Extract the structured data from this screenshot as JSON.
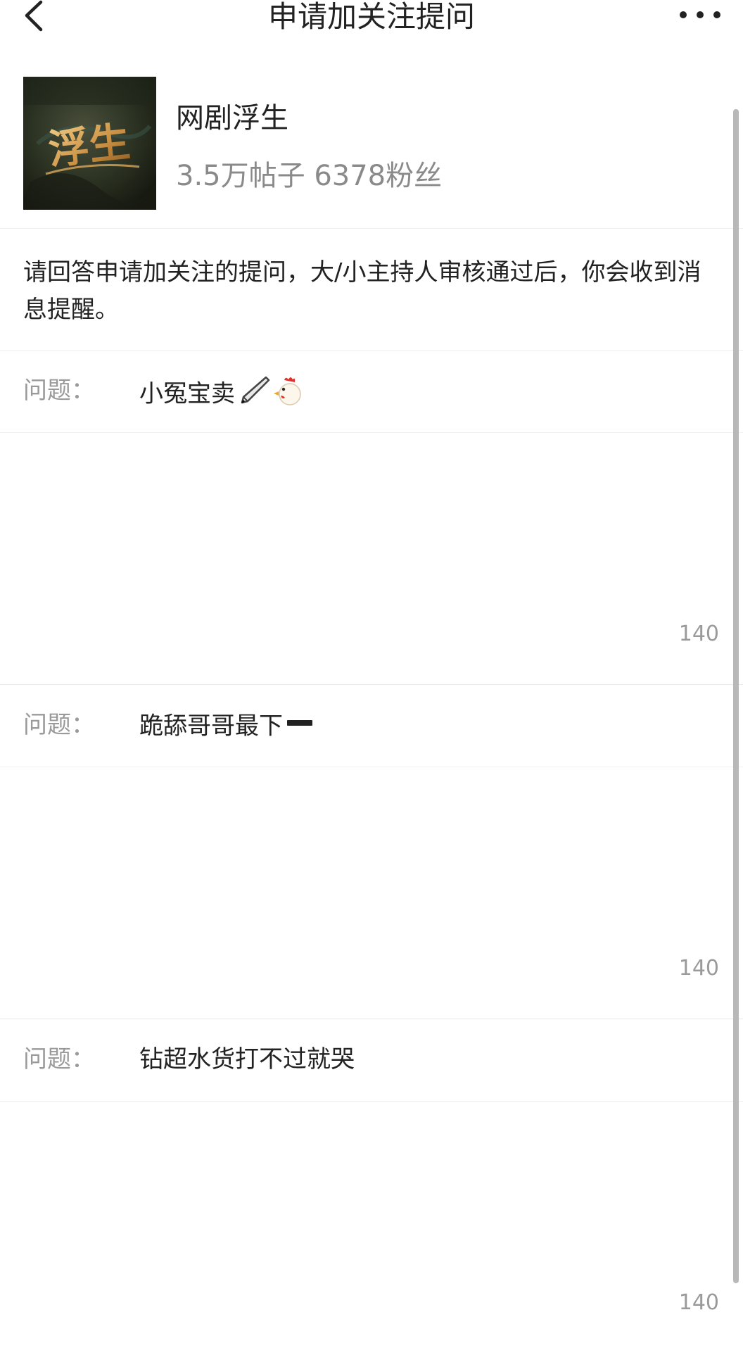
{
  "navbar": {
    "title": "申请加关注提问",
    "back_icon": "chevron-left-icon",
    "more_icon": "more-dots-icon"
  },
  "group": {
    "name": "网剧浮生",
    "stats": "3.5万帖子 6378粉丝",
    "avatar_text": "浮生",
    "avatar_icon": "group-avatar"
  },
  "notice": "请回答申请加关注的提问，大/小主持人审核通过后，你会收到消息提醒。",
  "questions": [
    {
      "label": "问题：",
      "text": "小冤宝卖",
      "emojis": [
        "pen-icon",
        "chicken-icon"
      ],
      "answer_value": "",
      "counter": "140"
    },
    {
      "label": "问题：",
      "text": "跪舔哥哥最下",
      "emojis": [
        "minus-icon"
      ],
      "answer_value": "",
      "counter": "140"
    },
    {
      "label": "问题：",
      "text": "钻超水货打不过就哭",
      "emojis": [],
      "answer_value": "",
      "counter": "140"
    }
  ],
  "colors": {
    "text_primary": "#222222",
    "text_secondary": "#8a8a8a",
    "divider": "#eeeeee",
    "avatar_gold": "#d9a75a"
  }
}
